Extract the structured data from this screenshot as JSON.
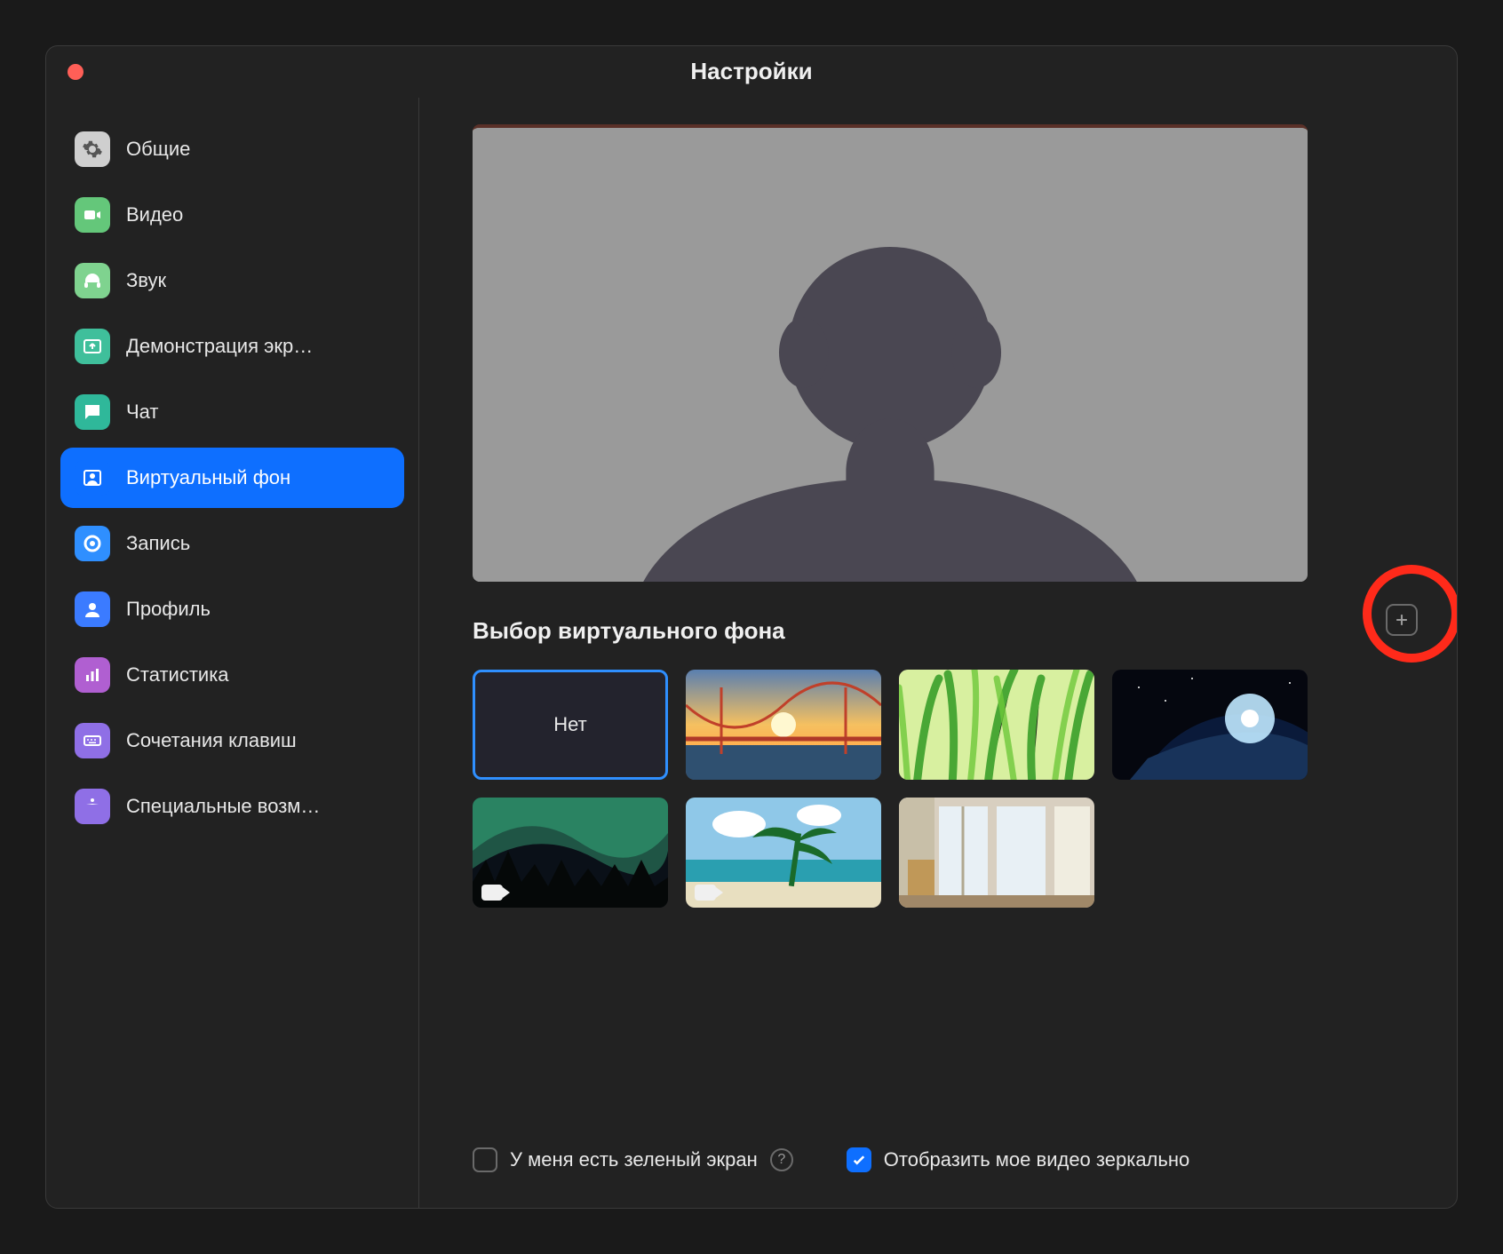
{
  "window": {
    "title": "Настройки"
  },
  "sidebar": {
    "items": [
      {
        "label": "Общие"
      },
      {
        "label": "Видео"
      },
      {
        "label": "Звук"
      },
      {
        "label": "Демонстрация экр…"
      },
      {
        "label": "Чат"
      },
      {
        "label": "Виртуальный фон"
      },
      {
        "label": "Запись"
      },
      {
        "label": "Профиль"
      },
      {
        "label": "Статистика"
      },
      {
        "label": "Сочетания клавиш"
      },
      {
        "label": "Специальные возм…"
      }
    ],
    "selected_index": 5
  },
  "main": {
    "section_title": "Выбор виртуального фона",
    "backgrounds": {
      "none_label": "Нет",
      "selected_index": 0,
      "tiles": [
        {
          "name": "none"
        },
        {
          "name": "golden-gate"
        },
        {
          "name": "grass"
        },
        {
          "name": "earth-space"
        },
        {
          "name": "aurora",
          "is_video": true
        },
        {
          "name": "beach",
          "is_video": true
        },
        {
          "name": "room"
        }
      ]
    },
    "options": {
      "green_screen": {
        "label": "У меня есть зеленый экран",
        "checked": false
      },
      "mirror": {
        "label": "Отобразить мое видео зеркально",
        "checked": true
      }
    }
  },
  "colors": {
    "accent": "#0e6fff",
    "highlight_ring": "#ff2a1a"
  }
}
